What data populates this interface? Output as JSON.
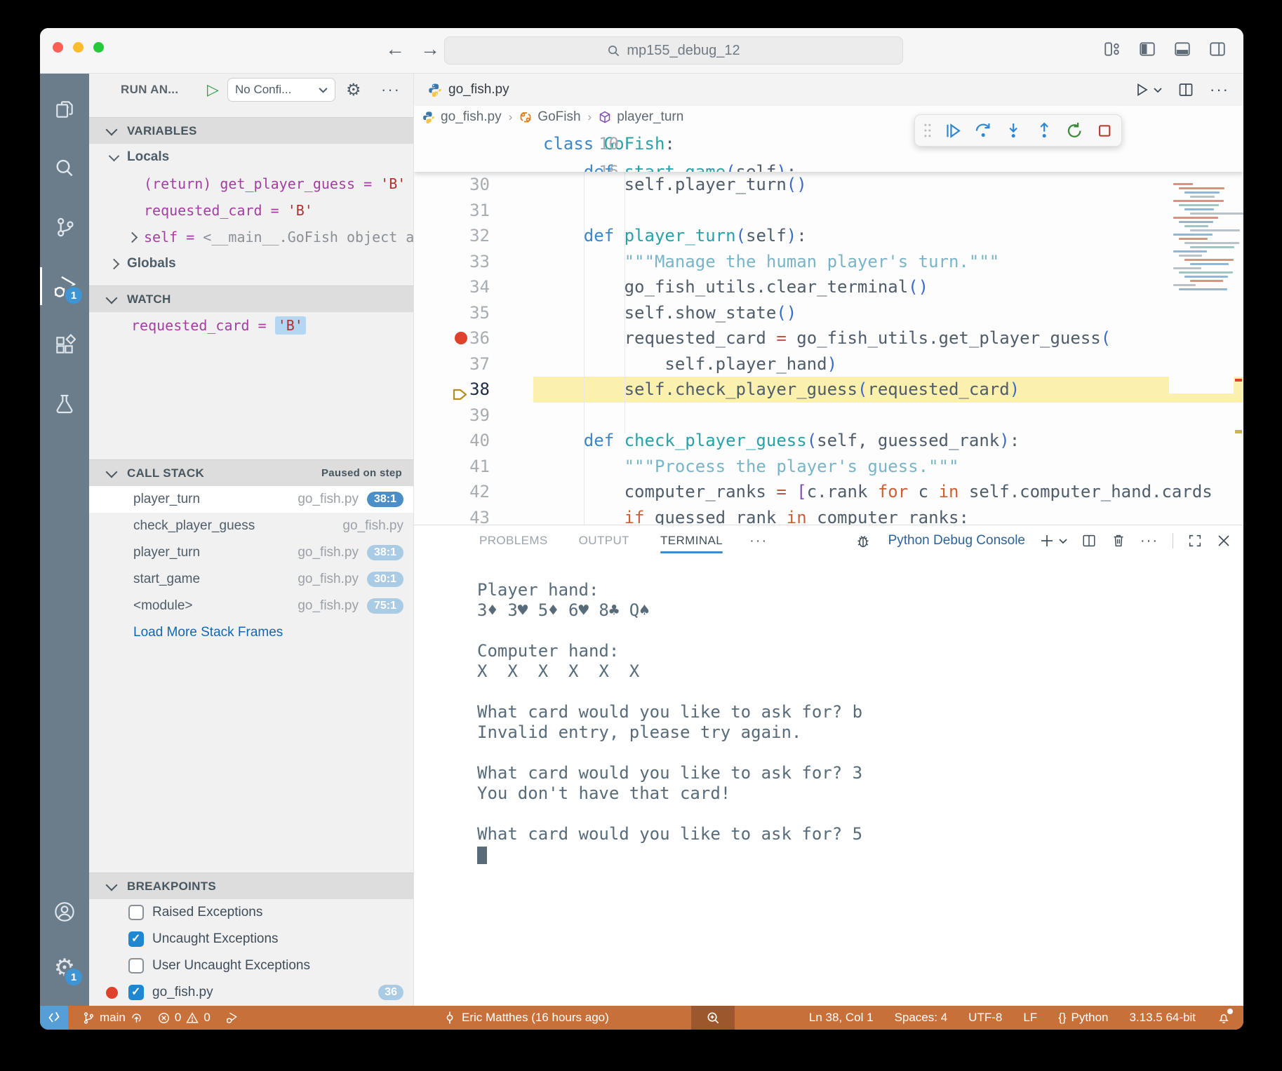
{
  "colors": {
    "status_bar": "#c8703a",
    "remote_chip": "#559fd6",
    "activity_bar": "#6b7d8b",
    "badge_blue": "#3e95d6",
    "breakpoint_red": "#e0412c",
    "current_line_highlight": "#fbf0ae",
    "callstack_badge_solid": "#4a8fc7",
    "callstack_badge_light": "#a9cbe4",
    "link_blue": "#1266b8",
    "panel_tab_underline": "#3c8bd0",
    "checkbox_checked": "#1f87d2",
    "watch_value_highlight": "#b3d7f3"
  },
  "titlebar": {
    "search": "mp155_debug_12"
  },
  "activity_bar": {
    "debug_badge": "1",
    "settings_badge": "1"
  },
  "sidebar": {
    "title": "RUN AN...",
    "config_dropdown": "No Confi...",
    "variables": {
      "header": "VARIABLES",
      "locals_label": "Locals",
      "globals_label": "Globals",
      "rows": [
        {
          "chev": "",
          "segs": [
            [
              "name",
              "(return) get_player_guess"
            ],
            [
              "op",
              " = "
            ],
            [
              "str",
              "'B'"
            ]
          ]
        },
        {
          "chev": "",
          "segs": [
            [
              "name",
              "requested_card"
            ],
            [
              "op",
              " = "
            ],
            [
              "str",
              "'B'"
            ]
          ]
        },
        {
          "chev": ">",
          "segs": [
            [
              "name",
              "self"
            ],
            [
              "op",
              " = "
            ],
            [
              "obj",
              "<__main__.GoFish object a…"
            ]
          ]
        }
      ]
    },
    "watch": {
      "header": "WATCH",
      "rows": [
        {
          "segs": [
            [
              "name",
              "requested_card"
            ],
            [
              "op",
              " = "
            ],
            [
              "strhl",
              "'B'"
            ]
          ]
        }
      ]
    },
    "call_stack": {
      "header": "CALL STACK",
      "status": "Paused on step",
      "frames": [
        {
          "name": "player_turn",
          "file": "go_fish.py",
          "badge": "38:1",
          "selected": true
        },
        {
          "name": "check_player_guess",
          "file": "go_fish.py",
          "badge": ""
        },
        {
          "name": "player_turn",
          "file": "go_fish.py",
          "badge": "38:1"
        },
        {
          "name": "start_game",
          "file": "go_fish.py",
          "badge": "30:1"
        },
        {
          "name": "<module>",
          "file": "go_fish.py",
          "badge": "75:1"
        }
      ],
      "load_more": "Load More Stack Frames"
    },
    "breakpoints": {
      "header": "BREAKPOINTS",
      "rows": [
        {
          "checked": false,
          "label": "Raised Exceptions"
        },
        {
          "checked": true,
          "label": "Uncaught Exceptions"
        },
        {
          "checked": false,
          "label": "User Uncaught Exceptions"
        },
        {
          "checked": true,
          "label": "go_fish.py",
          "dot": true,
          "badge": "36"
        }
      ]
    }
  },
  "editor": {
    "tab": "go_fish.py",
    "breadcrumb": [
      "go_fish.py",
      "GoFish",
      "player_turn"
    ],
    "sticky": {
      "num": "10",
      "segs": [
        [
          "k",
          "class "
        ],
        [
          "n",
          "GoFish"
        ],
        [
          "d",
          ":"
        ]
      ]
    },
    "sticky_partial": {
      "num": "16",
      "segs": [
        [
          "d",
          "    "
        ],
        [
          "k",
          "def "
        ],
        [
          "n",
          "start_game"
        ],
        [
          "p",
          "("
        ],
        [
          "d",
          "self"
        ],
        [
          "p",
          ")"
        ],
        [
          "d",
          ":"
        ]
      ]
    },
    "code_lines": [
      {
        "num": "30",
        "segs": [
          [
            "d",
            "        self.player_turn"
          ],
          [
            "p",
            "()"
          ]
        ]
      },
      {
        "num": "31",
        "segs": []
      },
      {
        "num": "32",
        "segs": [
          [
            "d",
            "    "
          ],
          [
            "k",
            "def "
          ],
          [
            "n",
            "player_turn"
          ],
          [
            "p",
            "("
          ],
          [
            "d",
            "self"
          ],
          [
            "p",
            ")"
          ],
          [
            "d",
            ":"
          ]
        ]
      },
      {
        "num": "33",
        "segs": [
          [
            "s",
            "        \"\"\"Manage the human player's turn.\"\"\""
          ]
        ]
      },
      {
        "num": "34",
        "segs": [
          [
            "d",
            "        go_fish_utils.clear_terminal"
          ],
          [
            "p",
            "()"
          ]
        ]
      },
      {
        "num": "35",
        "segs": [
          [
            "d",
            "        self.show_state"
          ],
          [
            "p",
            "()"
          ]
        ]
      },
      {
        "num": "36",
        "bp": true,
        "segs": [
          [
            "d",
            "        requested_card "
          ],
          [
            "o",
            "="
          ],
          [
            "d",
            " go_fish_utils.get_player_guess"
          ],
          [
            "p",
            "("
          ]
        ]
      },
      {
        "num": "37",
        "segs": [
          [
            "d",
            "            self.player_hand"
          ],
          [
            "p",
            ")"
          ]
        ]
      },
      {
        "num": "38",
        "cur": true,
        "segs": [
          [
            "d",
            "        self.check_player_guess"
          ],
          [
            "p",
            "("
          ],
          [
            "d",
            "requested_card"
          ],
          [
            "p",
            ")"
          ]
        ]
      },
      {
        "num": "39",
        "segs": []
      },
      {
        "num": "40",
        "segs": [
          [
            "d",
            "    "
          ],
          [
            "k",
            "def "
          ],
          [
            "n",
            "check_player_guess"
          ],
          [
            "p",
            "("
          ],
          [
            "d",
            "self, guessed_rank"
          ],
          [
            "p",
            ")"
          ],
          [
            "d",
            ":"
          ]
        ]
      },
      {
        "num": "41",
        "segs": [
          [
            "s",
            "        \"\"\"Process the player's guess.\"\"\""
          ]
        ]
      },
      {
        "num": "42",
        "segs": [
          [
            "d",
            "        computer_ranks "
          ],
          [
            "o",
            "="
          ],
          [
            "d",
            " "
          ],
          [
            "pp",
            "["
          ],
          [
            "d",
            "c.rank "
          ],
          [
            "f",
            "for"
          ],
          [
            "d",
            " c "
          ],
          [
            "f",
            "in"
          ],
          [
            "d",
            " self.computer_hand.cards"
          ]
        ]
      },
      {
        "num": "43",
        "segs": [
          [
            "d",
            "        "
          ],
          [
            "f",
            "if"
          ],
          [
            "d",
            " guessed_rank "
          ],
          [
            "f",
            "in"
          ],
          [
            "d",
            " computer_ranks:"
          ]
        ]
      }
    ]
  },
  "panel": {
    "tabs": [
      "PROBLEMS",
      "OUTPUT",
      "TERMINAL"
    ],
    "active_tab": "TERMINAL",
    "console_label": "Python Debug Console",
    "terminal_lines": [
      "Player hand:",
      "3♦ 3♥ 5♦ 6♥ 8♣ Q♠",
      "",
      "Computer hand:",
      "X  X  X  X  X  X",
      "",
      "What card would you like to ask for? b",
      "Invalid entry, please try again.",
      "",
      "What card would you like to ask for? 3",
      "You don't have that card!",
      "",
      "What card would you like to ask for? 5"
    ]
  },
  "status_bar": {
    "branch": "main",
    "errors": "0",
    "warnings": "0",
    "commit_info": "Eric Matthes (16 hours ago)",
    "cursor": "Ln 38, Col 1",
    "spaces": "Spaces: 4",
    "encoding": "UTF-8",
    "eol": "LF",
    "language": "Python",
    "interpreter": "3.13.5 64-bit"
  }
}
